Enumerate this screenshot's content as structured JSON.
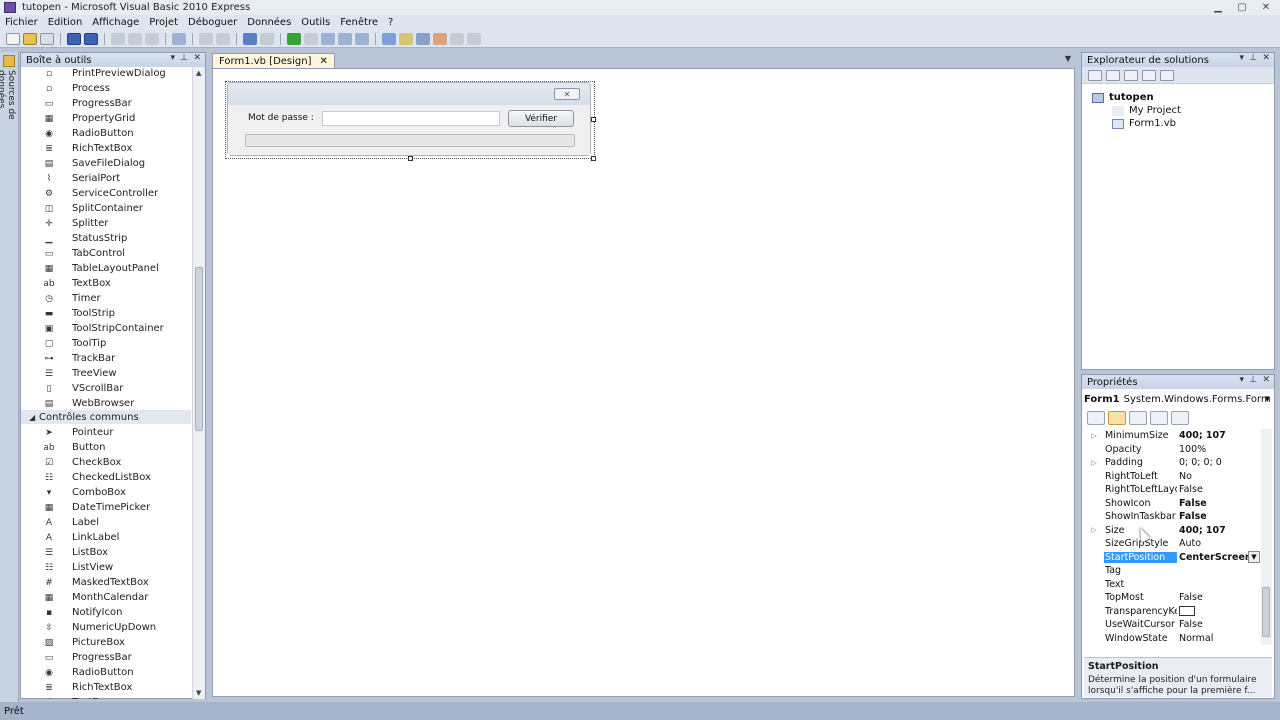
{
  "window": {
    "title": "tutopen - Microsoft Visual Basic 2010 Express"
  },
  "menu": [
    "Fichier",
    "Edition",
    "Affichage",
    "Projet",
    "Déboguer",
    "Données",
    "Outils",
    "Fenêtre",
    "?"
  ],
  "side_tab": {
    "label": "Sources de données"
  },
  "toolbox": {
    "title": "Boîte à outils",
    "partial_top": "PrintPreviewDialog",
    "items_all": [
      "Process",
      "ProgressBar",
      "PropertyGrid",
      "RadioButton",
      "RichTextBox",
      "SaveFileDialog",
      "SerialPort",
      "ServiceController",
      "SplitContainer",
      "Splitter",
      "StatusStrip",
      "TabControl",
      "TableLayoutPanel",
      "TextBox",
      "Timer",
      "ToolStrip",
      "ToolStripContainer",
      "ToolTip",
      "TrackBar",
      "TreeView",
      "VScrollBar",
      "WebBrowser"
    ],
    "category": "Contrôles communs",
    "items_common": [
      "Pointeur",
      "Button",
      "CheckBox",
      "CheckedListBox",
      "ComboBox",
      "DateTimePicker",
      "Label",
      "LinkLabel",
      "ListBox",
      "ListView",
      "MaskedTextBox",
      "MonthCalendar",
      "NotifyIcon",
      "NumericUpDown",
      "PictureBox",
      "ProgressBar",
      "RadioButton",
      "RichTextBox",
      "TextBox"
    ]
  },
  "editor": {
    "tab_label": "Form1.vb [Design]",
    "form": {
      "label": "Mot de passe :",
      "button": "Vérifier",
      "progress": 0
    }
  },
  "solution_explorer": {
    "title": "Explorateur de solutions",
    "tree": [
      "tutopen",
      "My Project",
      "Form1.vb"
    ]
  },
  "properties": {
    "title": "Propriétés",
    "object_name": "Form1",
    "object_type": "System.Windows.Forms.Form",
    "rows": [
      {
        "name": "MinimumSize",
        "value": "400; 107",
        "bold": true,
        "expand": true
      },
      {
        "name": "Opacity",
        "value": "100%",
        "bold": false,
        "expand": false
      },
      {
        "name": "Padding",
        "value": "0; 0; 0; 0",
        "bold": false,
        "expand": true
      },
      {
        "name": "RightToLeft",
        "value": "No",
        "bold": false,
        "expand": false
      },
      {
        "name": "RightToLeftLayout",
        "value": "False",
        "bold": false,
        "expand": false
      },
      {
        "name": "ShowIcon",
        "value": "False",
        "bold": true,
        "expand": false
      },
      {
        "name": "ShowInTaskbar",
        "value": "False",
        "bold": true,
        "expand": false
      },
      {
        "name": "Size",
        "value": "400; 107",
        "bold": true,
        "expand": true
      },
      {
        "name": "SizeGripStyle",
        "value": "Auto",
        "bold": false,
        "expand": false
      },
      {
        "name": "StartPosition",
        "value": "CenterScreen",
        "bold": true,
        "expand": false,
        "selected": true
      },
      {
        "name": "Tag",
        "value": "",
        "bold": false,
        "expand": false
      },
      {
        "name": "Text",
        "value": "",
        "bold": false,
        "expand": false
      },
      {
        "name": "TopMost",
        "value": "False",
        "bold": false,
        "expand": false
      },
      {
        "name": "TransparencyKey",
        "value": "",
        "bold": false,
        "expand": false,
        "swatch": true
      },
      {
        "name": "UseWaitCursor",
        "value": "False",
        "bold": false,
        "expand": false
      },
      {
        "name": "WindowState",
        "value": "Normal",
        "bold": false,
        "expand": false
      }
    ],
    "description": {
      "title": "StartPosition",
      "text": "Détermine la position d'un formulaire lorsqu'il s'affiche pour la première f..."
    }
  },
  "status": {
    "text": "Prêt"
  },
  "colors": {
    "selection": "#3399ff",
    "chrome": "#dfe5ee",
    "background": "#b9c4d6"
  }
}
